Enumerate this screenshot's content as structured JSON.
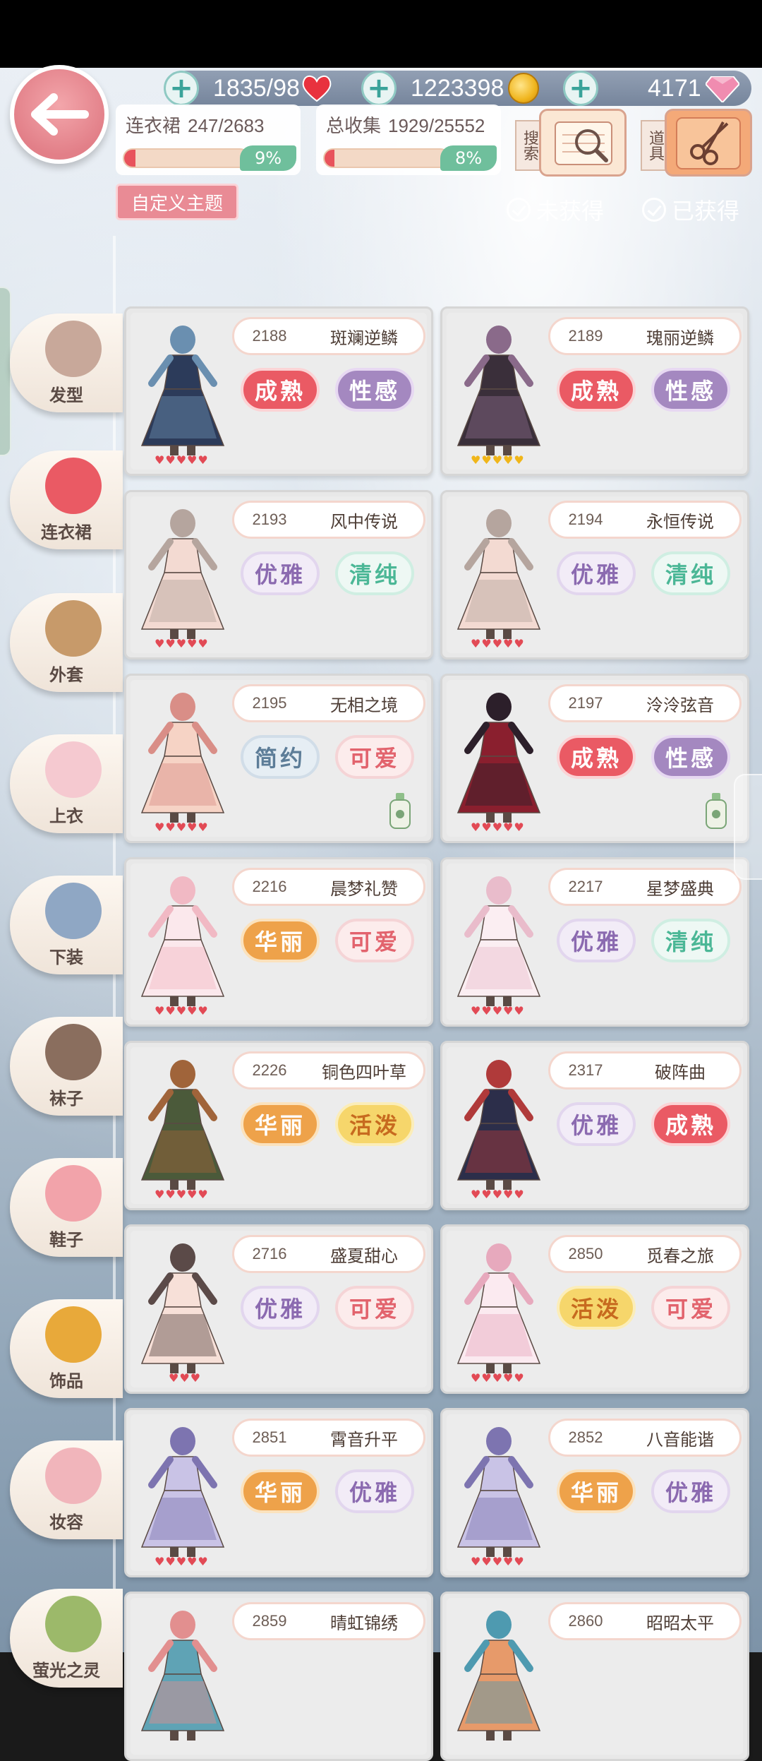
{
  "currency": {
    "stamina": "1835/98",
    "coins": "1223398",
    "gems": "4171"
  },
  "stats": {
    "dress": {
      "label": "连衣裙",
      "value": "247/2683",
      "percent": "9%",
      "fraction": 0.09
    },
    "total": {
      "label": "总收集",
      "value": "1929/25552",
      "percent": "8%",
      "fraction": 0.08
    }
  },
  "tools": {
    "search_label": "搜索",
    "items_label": "道具"
  },
  "custom_theme_label": "自定义主题",
  "filters": {
    "not_obtained": "未获得",
    "obtained": "已获得"
  },
  "categories": [
    {
      "label": "发型",
      "icon": "hair-icon"
    },
    {
      "label": "连衣裙",
      "icon": "dress-icon"
    },
    {
      "label": "外套",
      "icon": "coat-icon"
    },
    {
      "label": "上衣",
      "icon": "shirt-icon"
    },
    {
      "label": "下装",
      "icon": "pants-icon"
    },
    {
      "label": "袜子",
      "icon": "socks-icon"
    },
    {
      "label": "鞋子",
      "icon": "shoes-icon"
    },
    {
      "label": "饰品",
      "icon": "hat-icon"
    },
    {
      "label": "妆容",
      "icon": "makeup-icon"
    },
    {
      "label": "萤光之灵",
      "icon": "branch-icon"
    }
  ],
  "cards": [
    {
      "id": "2188",
      "name": "斑斓逆鳞",
      "tags": [
        "成熟",
        "性感"
      ],
      "tag_styles": [
        "red",
        "purple"
      ],
      "stars": 5,
      "star_color": "red"
    },
    {
      "id": "2189",
      "name": "瑰丽逆鳞",
      "tags": [
        "成熟",
        "性感"
      ],
      "tag_styles": [
        "red",
        "purple"
      ],
      "stars": 5,
      "star_color": "gold"
    },
    {
      "id": "2193",
      "name": "风中传说",
      "tags": [
        "优雅",
        "清纯"
      ],
      "tag_styles": [
        "lilac",
        "mint"
      ],
      "stars": 5,
      "star_color": "red"
    },
    {
      "id": "2194",
      "name": "永恒传说",
      "tags": [
        "优雅",
        "清纯"
      ],
      "tag_styles": [
        "lilac",
        "mint"
      ],
      "stars": 5,
      "star_color": "red"
    },
    {
      "id": "2195",
      "name": "无相之境",
      "tags": [
        "简约",
        "可爱"
      ],
      "tag_styles": [
        "blue",
        "pinkt"
      ],
      "stars": 5,
      "star_color": "red"
    },
    {
      "id": "2197",
      "name": "泠泠弦音",
      "tags": [
        "成熟",
        "性感"
      ],
      "tag_styles": [
        "red",
        "purple"
      ],
      "stars": 5,
      "star_color": "red"
    },
    {
      "id": "2216",
      "name": "晨梦礼赞",
      "tags": [
        "华丽",
        "可爱"
      ],
      "tag_styles": [
        "gold",
        "pinkt"
      ],
      "stars": 5,
      "star_color": "red"
    },
    {
      "id": "2217",
      "name": "星梦盛典",
      "tags": [
        "优雅",
        "清纯"
      ],
      "tag_styles": [
        "lilac",
        "mint"
      ],
      "stars": 5,
      "star_color": "red"
    },
    {
      "id": "2226",
      "name": "铜色四叶草",
      "tags": [
        "华丽",
        "活泼"
      ],
      "tag_styles": [
        "gold",
        "yellow"
      ],
      "stars": 5,
      "star_color": "red"
    },
    {
      "id": "2317",
      "name": "破阵曲",
      "tags": [
        "优雅",
        "成熟"
      ],
      "tag_styles": [
        "lilac",
        "red"
      ],
      "stars": 5,
      "star_color": "red"
    },
    {
      "id": "2716",
      "name": "盛夏甜心",
      "tags": [
        "优雅",
        "可爱"
      ],
      "tag_styles": [
        "lilac",
        "pinkt"
      ],
      "stars": 3,
      "star_color": "red"
    },
    {
      "id": "2850",
      "name": "觅春之旅",
      "tags": [
        "活泼",
        "可爱"
      ],
      "tag_styles": [
        "yellow",
        "pinkt"
      ],
      "stars": 5,
      "star_color": "red"
    },
    {
      "id": "2851",
      "name": "霄音升平",
      "tags": [
        "华丽",
        "优雅"
      ],
      "tag_styles": [
        "gold",
        "lilac"
      ],
      "stars": 5,
      "star_color": "red"
    },
    {
      "id": "2852",
      "name": "八音能谐",
      "tags": [
        "华丽",
        "优雅"
      ],
      "tag_styles": [
        "gold",
        "lilac"
      ],
      "stars": 5,
      "star_color": "red"
    },
    {
      "id": "2859",
      "name": "晴虹锦绣",
      "tags": [],
      "tag_styles": [],
      "stars": 0,
      "star_color": "red"
    },
    {
      "id": "2860",
      "name": "昭昭太平",
      "tags": [],
      "tag_styles": [],
      "stars": 0,
      "star_color": "red"
    }
  ]
}
